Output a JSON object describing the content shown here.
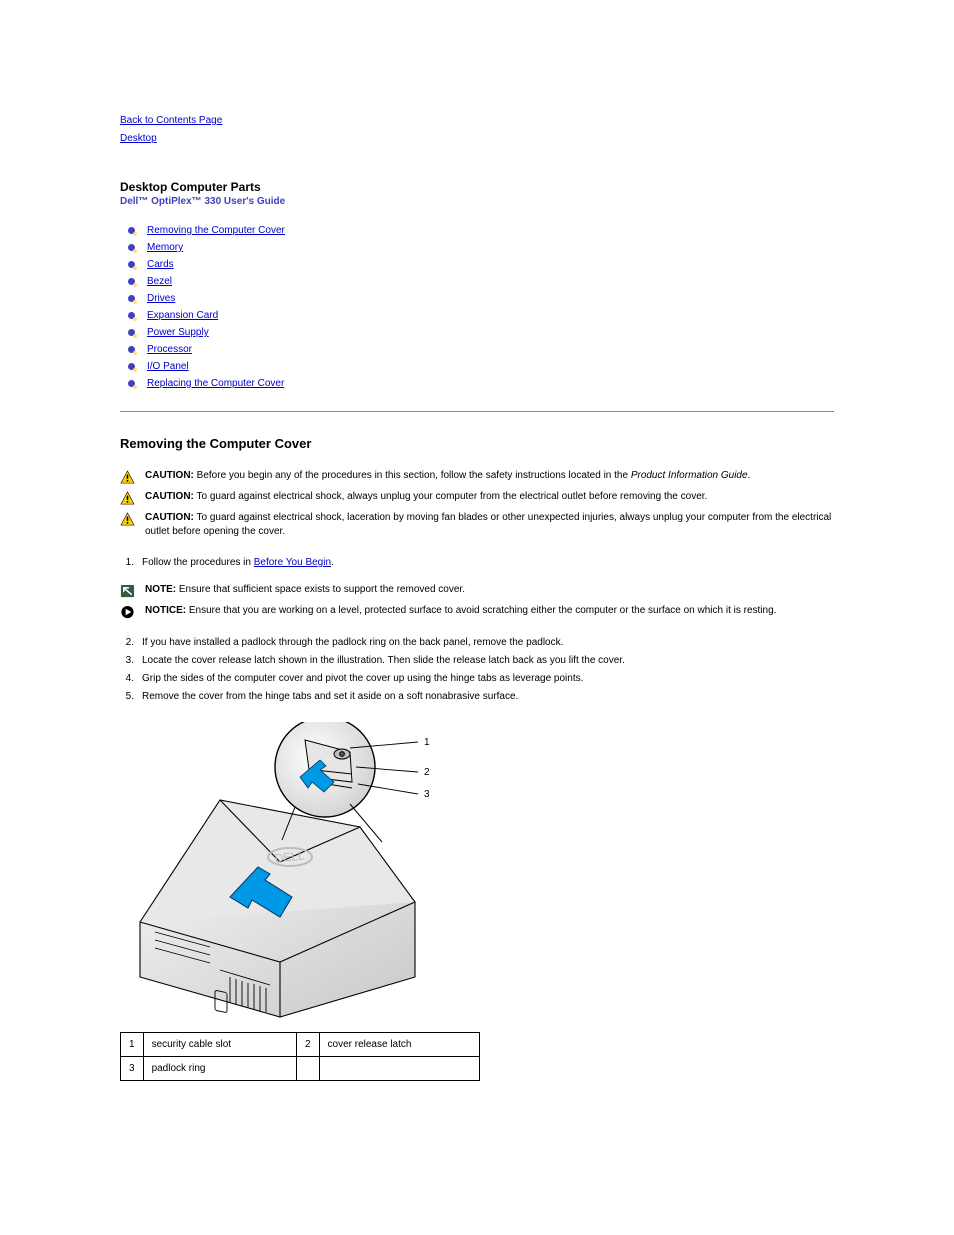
{
  "nav": {
    "back": "Back to Contents Page",
    "desktop": "Desktop"
  },
  "title": "Desktop Computer Parts",
  "subtitle": "Dell™ OptiPlex™ 330 User's Guide",
  "toc": [
    "Removing the Computer Cover",
    "Memory",
    "Cards",
    "Bezel",
    "Drives",
    "Expansion Card",
    "Power Supply",
    "Processor",
    "I/O Panel",
    "Replacing the Computer Cover"
  ],
  "section": {
    "heading": "Removing the Computer Cover",
    "notices": [
      {
        "icon": "caution",
        "label": "CAUTION:",
        "text": "Before you begin any of the procedures in this section, follow the safety instructions located in the ",
        "emText": "Product Information Guide",
        "after": "."
      },
      {
        "icon": "caution",
        "label": "CAUTION:",
        "text": "To guard against electrical shock, always unplug your computer from the electrical outlet before removing the cover."
      },
      {
        "icon": "caution",
        "label": "CAUTION:",
        "text": "To guard against electrical shock, laceration by moving fan blades or other unexpected injuries, always unplug your computer from the electrical outlet before opening the cover."
      }
    ],
    "steps": [
      {
        "n": "1.",
        "text": "Follow the procedures in ",
        "linkText": "Before You Begin",
        "after": "."
      }
    ],
    "noteRow": {
      "label": "NOTE:",
      "text": "Ensure that sufficient space exists to support the removed cover."
    },
    "noticeRow": {
      "label": "NOTICE:",
      "text": "Ensure that you are working on a level, protected surface to avoid scratching either the computer or the surface on which it is resting."
    },
    "afterSteps": [
      {
        "n": "2.",
        "text": "If you have installed a padlock through the padlock ring on the back panel, remove the padlock."
      },
      {
        "n": "3.",
        "text": "Locate the cover release latch shown in the illustration. Then slide the release latch back as you lift the cover."
      },
      {
        "n": "4.",
        "text": "Grip the sides of the computer cover and pivot the cover up using the hinge tabs as leverage points."
      },
      {
        "n": "5.",
        "text": "Remove the cover from the hinge tabs and set it aside on a soft nonabrasive surface."
      }
    ]
  },
  "labelsTable": [
    {
      "n": "1",
      "label": "security cable slot",
      "n2": "2",
      "label2": "cover release latch"
    },
    {
      "n": "3",
      "label": "padlock ring",
      "n2": "",
      "label2": ""
    }
  ]
}
